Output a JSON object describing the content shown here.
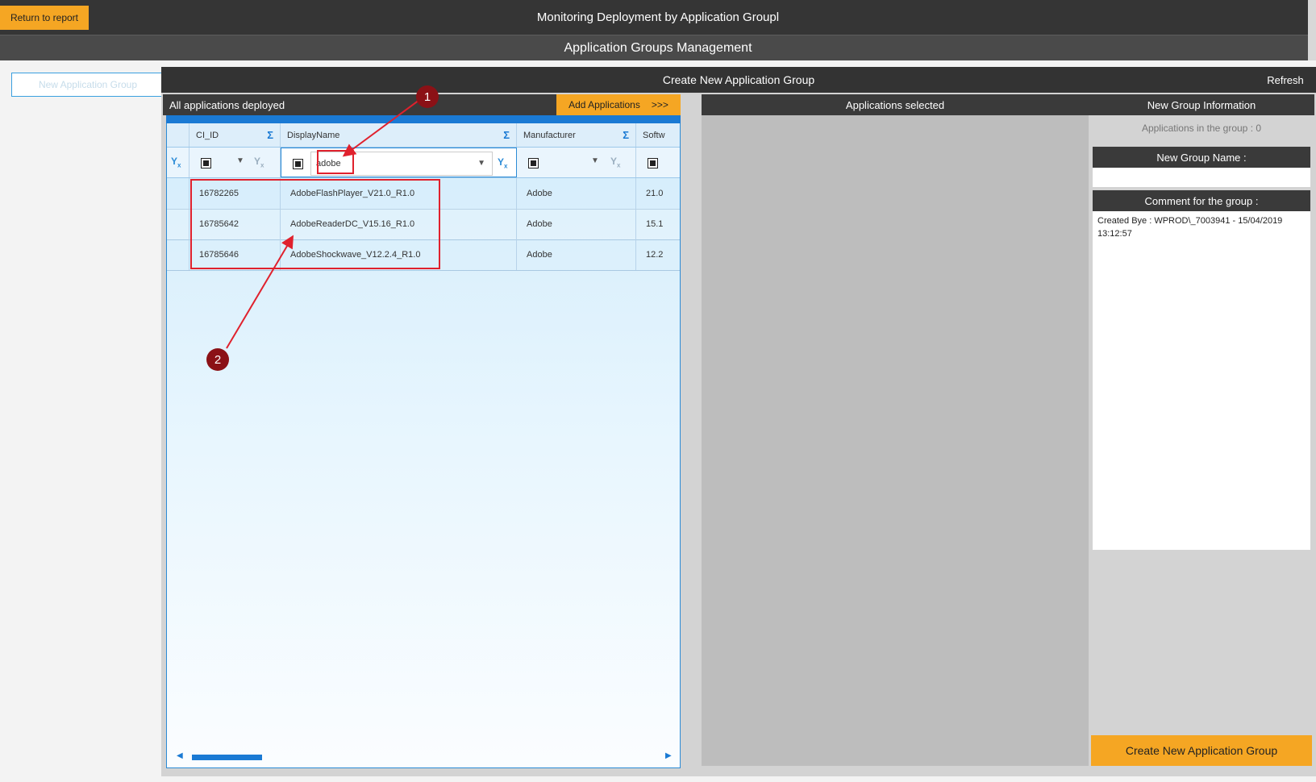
{
  "topbar": {
    "return_label": "Return to report",
    "title": "Monitoring Deployment by Application Groupl"
  },
  "subbar": {
    "title": "Application Groups Management"
  },
  "background": {
    "new_group_button": "New Application Group"
  },
  "modal": {
    "title": "Create New Application Group",
    "refresh_label": "Refresh",
    "left_panel": {
      "title": "All applications deployed",
      "add_button": "Add Applications",
      "add_arrows": ">>>",
      "columns": [
        "CI_ID",
        "DisplayName",
        "Manufacturer",
        "Softw"
      ],
      "filter_value": "adobe",
      "rows": [
        {
          "ci_id": "16782265",
          "display_name": "AdobeFlashPlayer_V21.0_R1.0",
          "manufacturer": "Adobe",
          "software": "21.0"
        },
        {
          "ci_id": "16785642",
          "display_name": "AdobeReaderDC_V15.16_R1.0",
          "manufacturer": "Adobe",
          "software": "15.1"
        },
        {
          "ci_id": "16785646",
          "display_name": "AdobeShockwave_V12.2.4_R1.0",
          "manufacturer": "Adobe",
          "software": "12.2"
        }
      ]
    },
    "middle_panel": {
      "title": "Applications selected"
    },
    "right_panel": {
      "title": "New Group Information",
      "apps_count": "Applications in the group : 0",
      "name_label": "New Group Name :",
      "comment_label": "Comment for the group :",
      "comment_text": "Created Bye : WPROD\\_7003941 - 15/04/2019 13:12:57",
      "create_button": "Create New Application Group"
    }
  },
  "annotations": {
    "marker_1": "1",
    "marker_2": "2"
  },
  "colors": {
    "accent_orange": "#f5a623",
    "dark_bar": "#353535",
    "grid_blue": "#1a7ad4",
    "annotation_red": "#e0212d"
  }
}
